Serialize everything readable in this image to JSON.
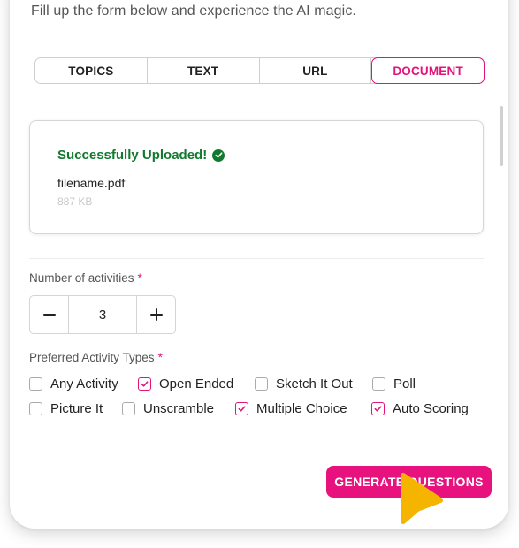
{
  "header": {
    "subtitle": "Fill up the form below and experience the AI magic."
  },
  "tabs": [
    {
      "label": "TOPICS",
      "active": false
    },
    {
      "label": "TEXT",
      "active": false
    },
    {
      "label": "URL",
      "active": false
    },
    {
      "label": "DOCUMENT",
      "active": true
    }
  ],
  "upload": {
    "status": "Successfully Uploaded!",
    "filename": "filename.pdf",
    "filesize": "887 KB"
  },
  "activities": {
    "label": "Number of activities",
    "required_mark": "*",
    "value": "3",
    "decrement_icon": "minus-icon",
    "increment_icon": "plus-icon"
  },
  "activity_types": {
    "label": "Preferred Activity Types",
    "required_mark": "*",
    "options": [
      {
        "label": "Any Activity",
        "checked": false
      },
      {
        "label": "Open Ended",
        "checked": true
      },
      {
        "label": "Sketch It Out",
        "checked": false
      },
      {
        "label": "Poll",
        "checked": false
      },
      {
        "label": "Picture It",
        "checked": false
      },
      {
        "label": "Unscramble",
        "checked": false
      },
      {
        "label": "Multiple Choice",
        "checked": true
      },
      {
        "label": "Auto Scoring",
        "checked": true
      }
    ]
  },
  "actions": {
    "generate_label": "GENERATE QUESTIONS"
  },
  "colors": {
    "accent": "#e8127f",
    "success": "#127a2e",
    "cursor": "#f5b400"
  }
}
